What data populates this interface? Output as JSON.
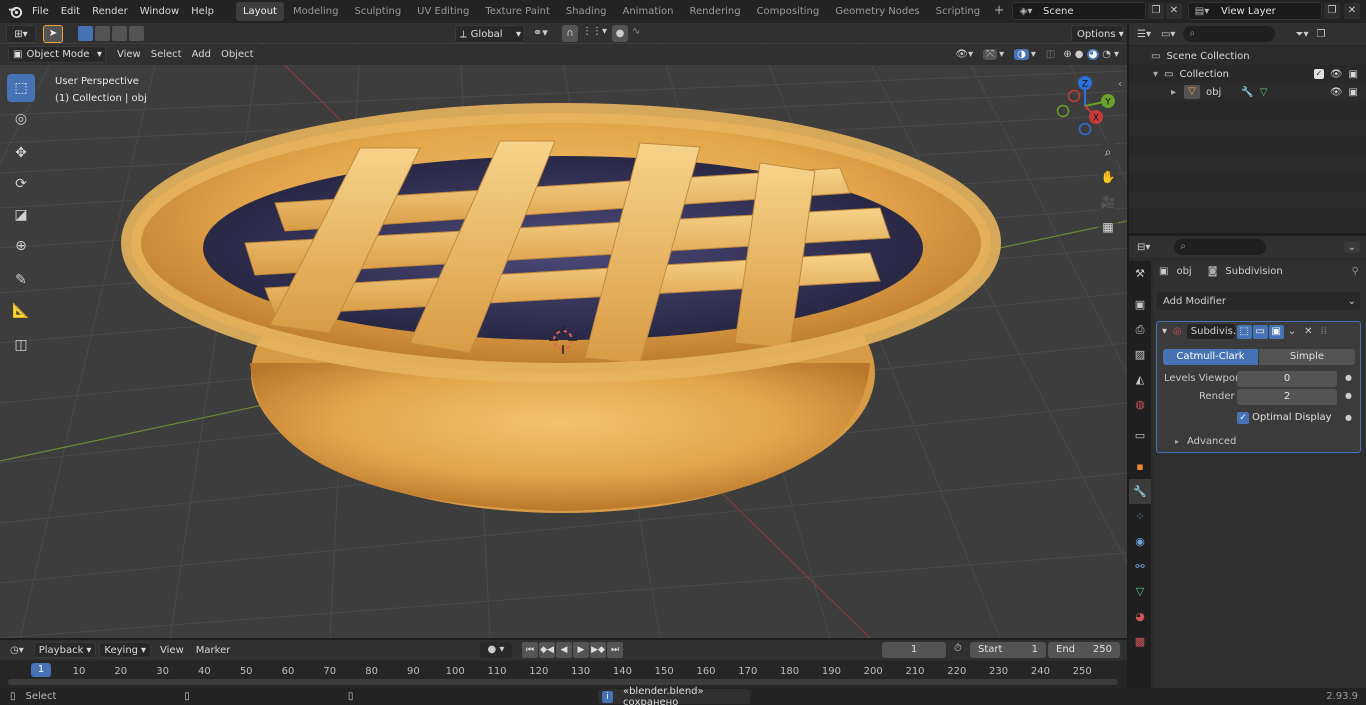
{
  "topbar": {
    "menus": [
      "File",
      "Edit",
      "Render",
      "Window",
      "Help"
    ],
    "workspaces": [
      "Layout",
      "Modeling",
      "Sculpting",
      "UV Editing",
      "Texture Paint",
      "Shading",
      "Animation",
      "Rendering",
      "Compositing",
      "Geometry Nodes",
      "Scripting"
    ],
    "active_workspace": "Layout",
    "scene": "Scene",
    "view_layer": "View Layer"
  },
  "viewport_header": {
    "mode": "Object Mode",
    "menus": [
      "View",
      "Select",
      "Add",
      "Object"
    ],
    "transform_orientation": "Global",
    "options_label": "Options"
  },
  "viewport": {
    "perspective_label": "User Perspective",
    "collection_label": "(1) Collection | obj",
    "gizmo": {
      "x": "X",
      "y": "Y",
      "z": "Z"
    }
  },
  "outliner": {
    "scene_collection": "Scene Collection",
    "collection": "Collection",
    "object": "obj"
  },
  "properties": {
    "object_name": "obj",
    "modifier_name": "Subdivision",
    "add_modifier_label": "Add Modifier",
    "panel_name": "Subdivis...",
    "catmull_clark": "Catmull-Clark",
    "simple": "Simple",
    "levels_viewport_label": "Levels Viewport",
    "levels_viewport_value": "0",
    "render_label": "Render",
    "render_value": "2",
    "optimal_display_label": "Optimal Display",
    "advanced_label": "Advanced"
  },
  "timeline": {
    "menus": [
      "Playback",
      "Keying",
      "View",
      "Marker"
    ],
    "current_frame": "1",
    "start_label": "Start",
    "start_value": "1",
    "end_label": "End",
    "end_value": "250",
    "frame_marker": "1",
    "frame_ticks": [
      "10",
      "20",
      "30",
      "40",
      "50",
      "60",
      "70",
      "80",
      "90",
      "100",
      "110",
      "120",
      "130",
      "140",
      "150",
      "160",
      "170",
      "180",
      "190",
      "200",
      "210",
      "220",
      "230",
      "240",
      "250"
    ]
  },
  "statusbar": {
    "left_label": "Select",
    "message": "«blender.blend» сохранено",
    "version": "2.93.9"
  },
  "colors": {
    "accent": "#4772b3",
    "axis_x": "#c33a3a",
    "axis_y": "#6aa32a",
    "axis_z": "#2f6fd8"
  }
}
